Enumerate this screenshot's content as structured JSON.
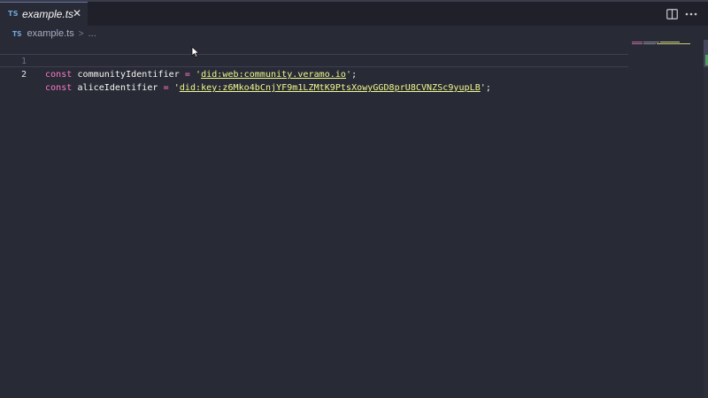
{
  "tab": {
    "lang_badge": "TS",
    "title": "example.ts",
    "close_glyph": "✕"
  },
  "breadcrumb": {
    "lang_badge": "TS",
    "file": "example.ts",
    "separator": ">",
    "more": "..."
  },
  "editor": {
    "lines": [
      {
        "number": "1",
        "keyword": "const",
        "identifier": "communityIdentifier",
        "operator": "=",
        "quote_open": "'",
        "value": "did:web:community.veramo.io",
        "quote_close": "'",
        "terminator": ";"
      },
      {
        "number": "2",
        "keyword": "const",
        "identifier": "aliceIdentifier",
        "operator": "=",
        "quote_open": "'",
        "value": "did:key:z6Mko4bCnjYF9m1LZMtK9PtsXowyGGD8prU8CVNZSc9yupLB",
        "quote_close": "'",
        "terminator": ";"
      }
    ],
    "current_line": 2
  },
  "icons": {
    "split_editor": "split-editor-icon",
    "more_actions": "more-actions-icon",
    "mouse_cursor": "mouse-cursor-icon"
  },
  "colors": {
    "background": "#282a36",
    "tab_bar": "#1f2029",
    "keyword": "#ff79c6",
    "string": "#f1fa8c",
    "foreground": "#f8f8f2",
    "line_number": "#6d7086",
    "ts_badge": "#6ea6d8"
  }
}
